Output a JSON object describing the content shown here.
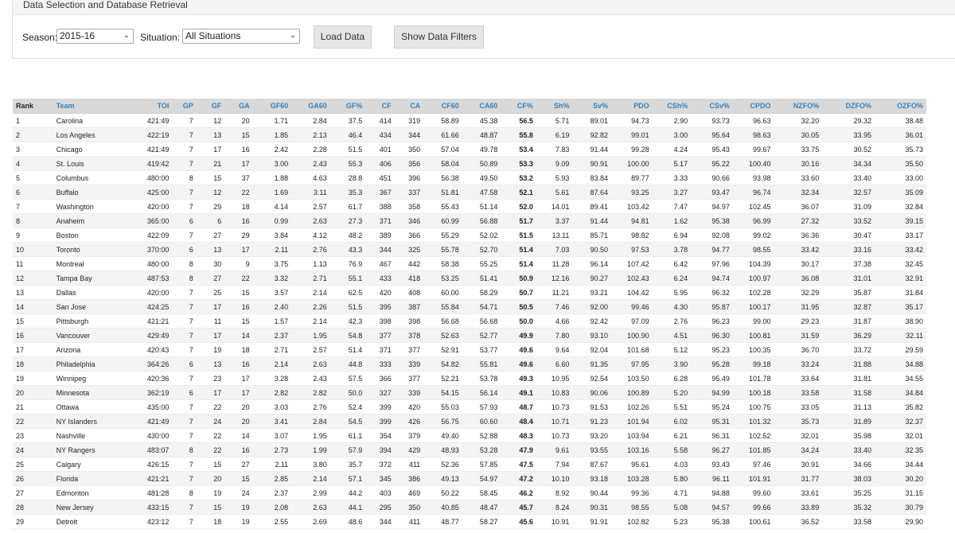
{
  "panel": {
    "title": "Data Selection and Database Retrieval",
    "season_label": "Season:",
    "season_value": "2015-16",
    "situation_label": "Situation:",
    "situation_value": "All Situations",
    "load_button": "Load Data",
    "filters_button": "Show Data Filters"
  },
  "table": {
    "columns": [
      "Rank",
      "Team",
      "TOI",
      "GP",
      "GF",
      "GA",
      "GF60",
      "GA60",
      "GF%",
      "CF",
      "CA",
      "CF60",
      "CA60",
      "CF%",
      "Sh%",
      "Sv%",
      "PDO",
      "CSh%",
      "CSv%",
      "CPDO",
      "NZFO%",
      "DZFO%",
      "OZFO%"
    ],
    "rows": [
      [
        "1",
        "Carolina",
        "421:49",
        "7",
        "12",
        "20",
        "1.71",
        "2.84",
        "37.5",
        "414",
        "319",
        "58.89",
        "45.38",
        "56.5",
        "5.71",
        "89.01",
        "94.73",
        "2.90",
        "93.73",
        "96.63",
        "32.20",
        "29.32",
        "38.48"
      ],
      [
        "2",
        "Los Angeles",
        "422:19",
        "7",
        "13",
        "15",
        "1.85",
        "2.13",
        "46.4",
        "434",
        "344",
        "61.66",
        "48.87",
        "55.8",
        "6.19",
        "92.82",
        "99.01",
        "3.00",
        "95.64",
        "98.63",
        "30.05",
        "33.95",
        "36.01"
      ],
      [
        "3",
        "Chicago",
        "421:49",
        "7",
        "17",
        "16",
        "2.42",
        "2.28",
        "51.5",
        "401",
        "350",
        "57.04",
        "49.78",
        "53.4",
        "7.83",
        "91.44",
        "99.28",
        "4.24",
        "95.43",
        "99.67",
        "33.75",
        "30.52",
        "35.73"
      ],
      [
        "4",
        "St. Louis",
        "419:42",
        "7",
        "21",
        "17",
        "3.00",
        "2.43",
        "55.3",
        "406",
        "356",
        "58.04",
        "50.89",
        "53.3",
        "9.09",
        "90.91",
        "100.00",
        "5.17",
        "95.22",
        "100.40",
        "30.16",
        "34.34",
        "35.50"
      ],
      [
        "5",
        "Columbus",
        "480:00",
        "8",
        "15",
        "37",
        "1.88",
        "4.63",
        "28.8",
        "451",
        "396",
        "56.38",
        "49.50",
        "53.2",
        "5.93",
        "83.84",
        "89.77",
        "3.33",
        "90.66",
        "93.98",
        "33.60",
        "33.40",
        "33.00"
      ],
      [
        "6",
        "Buffalo",
        "425:00",
        "7",
        "12",
        "22",
        "1.69",
        "3.11",
        "35.3",
        "367",
        "337",
        "51.81",
        "47.58",
        "52.1",
        "5.61",
        "87.64",
        "93.25",
        "3.27",
        "93.47",
        "96.74",
        "32.34",
        "32.57",
        "35.09"
      ],
      [
        "7",
        "Washington",
        "420:00",
        "7",
        "29",
        "18",
        "4.14",
        "2.57",
        "61.7",
        "388",
        "358",
        "55.43",
        "51.14",
        "52.0",
        "14.01",
        "89.41",
        "103.42",
        "7.47",
        "94.97",
        "102.45",
        "36.07",
        "31.09",
        "32.84"
      ],
      [
        "8",
        "Anaheim",
        "365:00",
        "6",
        "6",
        "16",
        "0.99",
        "2.63",
        "27.3",
        "371",
        "346",
        "60.99",
        "56.88",
        "51.7",
        "3.37",
        "91.44",
        "94.81",
        "1.62",
        "95.38",
        "96.99",
        "27.32",
        "33.52",
        "39.15"
      ],
      [
        "9",
        "Boston",
        "422:09",
        "7",
        "27",
        "29",
        "3.84",
        "4.12",
        "48.2",
        "389",
        "366",
        "55.29",
        "52.02",
        "51.5",
        "13.11",
        "85.71",
        "98.82",
        "6.94",
        "92.08",
        "99.02",
        "36.36",
        "30.47",
        "33.17"
      ],
      [
        "10",
        "Toronto",
        "370:00",
        "6",
        "13",
        "17",
        "2.11",
        "2.76",
        "43.3",
        "344",
        "325",
        "55.78",
        "52.70",
        "51.4",
        "7.03",
        "90.50",
        "97.53",
        "3.78",
        "94.77",
        "98.55",
        "33.42",
        "33.16",
        "33.42"
      ],
      [
        "11",
        "Montreal",
        "480:00",
        "8",
        "30",
        "9",
        "3.75",
        "1.13",
        "76.9",
        "467",
        "442",
        "58.38",
        "55.25",
        "51.4",
        "11.28",
        "96.14",
        "107.42",
        "6.42",
        "97.96",
        "104.39",
        "30.17",
        "37.38",
        "32.45"
      ],
      [
        "12",
        "Tampa Bay",
        "487:53",
        "8",
        "27",
        "22",
        "3.32",
        "2.71",
        "55.1",
        "433",
        "418",
        "53.25",
        "51.41",
        "50.9",
        "12.16",
        "90.27",
        "102.43",
        "6.24",
        "94.74",
        "100.97",
        "36.08",
        "31.01",
        "32.91"
      ],
      [
        "13",
        "Dallas",
        "420:00",
        "7",
        "25",
        "15",
        "3.57",
        "2.14",
        "62.5",
        "420",
        "408",
        "60.00",
        "58.29",
        "50.7",
        "11.21",
        "93.21",
        "104.42",
        "5.95",
        "96.32",
        "102.28",
        "32.29",
        "35.87",
        "31.84"
      ],
      [
        "14",
        "San Jose",
        "424:25",
        "7",
        "17",
        "16",
        "2.40",
        "2.26",
        "51.5",
        "395",
        "387",
        "55.84",
        "54.71",
        "50.5",
        "7.46",
        "92.00",
        "99.46",
        "4.30",
        "95.87",
        "100.17",
        "31.95",
        "32.87",
        "35.17"
      ],
      [
        "15",
        "Pittsburgh",
        "421:21",
        "7",
        "11",
        "15",
        "1.57",
        "2.14",
        "42.3",
        "398",
        "398",
        "56.68",
        "56.68",
        "50.0",
        "4.66",
        "92.42",
        "97.09",
        "2.76",
        "96.23",
        "99.00",
        "29.23",
        "31.87",
        "38.90"
      ],
      [
        "16",
        "Vancouver",
        "429:49",
        "7",
        "17",
        "14",
        "2.37",
        "1.95",
        "54.8",
        "377",
        "378",
        "52.63",
        "52.77",
        "49.9",
        "7.80",
        "93.10",
        "100.90",
        "4.51",
        "96.30",
        "100.81",
        "31.59",
        "36.29",
        "32.11"
      ],
      [
        "17",
        "Arizona",
        "420:43",
        "7",
        "19",
        "18",
        "2.71",
        "2.57",
        "51.4",
        "371",
        "377",
        "52.91",
        "53.77",
        "49.6",
        "9.64",
        "92.04",
        "101.68",
        "5.12",
        "95.23",
        "100.35",
        "36.70",
        "33.72",
        "29.59"
      ],
      [
        "18",
        "Philadelphia",
        "364:26",
        "6",
        "13",
        "16",
        "2.14",
        "2.63",
        "44.8",
        "333",
        "339",
        "54.82",
        "55.81",
        "49.6",
        "6.60",
        "91.35",
        "97.95",
        "3.90",
        "95.28",
        "99.18",
        "33.24",
        "31.88",
        "34.88"
      ],
      [
        "19",
        "Winnipeg",
        "420:36",
        "7",
        "23",
        "17",
        "3.28",
        "2.43",
        "57.5",
        "366",
        "377",
        "52.21",
        "53.78",
        "49.3",
        "10.95",
        "92.54",
        "103.50",
        "6.28",
        "95.49",
        "101.78",
        "33.64",
        "31.81",
        "34.55"
      ],
      [
        "20",
        "Minnesota",
        "362:19",
        "6",
        "17",
        "17",
        "2.82",
        "2.82",
        "50.0",
        "327",
        "339",
        "54.15",
        "56.14",
        "49.1",
        "10.83",
        "90.06",
        "100.89",
        "5.20",
        "94.99",
        "100.18",
        "33.58",
        "31.58",
        "34.84"
      ],
      [
        "21",
        "Ottawa",
        "435:00",
        "7",
        "22",
        "20",
        "3.03",
        "2.76",
        "52.4",
        "399",
        "420",
        "55.03",
        "57.93",
        "48.7",
        "10.73",
        "91.53",
        "102.26",
        "5.51",
        "95.24",
        "100.75",
        "33.05",
        "31.13",
        "35.82"
      ],
      [
        "22",
        "NY Islanders",
        "421:49",
        "7",
        "24",
        "20",
        "3.41",
        "2.84",
        "54.5",
        "399",
        "426",
        "56.75",
        "60.60",
        "48.4",
        "10.71",
        "91.23",
        "101.94",
        "6.02",
        "95.31",
        "101.32",
        "35.73",
        "31.89",
        "32.37"
      ],
      [
        "23",
        "Nashville",
        "430:00",
        "7",
        "22",
        "14",
        "3.07",
        "1.95",
        "61.1",
        "354",
        "379",
        "49.40",
        "52.88",
        "48.3",
        "10.73",
        "93.20",
        "103.94",
        "6.21",
        "96.31",
        "102.52",
        "32.01",
        "35.98",
        "32.01"
      ],
      [
        "24",
        "NY Rangers",
        "483:07",
        "8",
        "22",
        "16",
        "2.73",
        "1.99",
        "57.9",
        "394",
        "429",
        "48.93",
        "53.28",
        "47.9",
        "9.61",
        "93.55",
        "103.16",
        "5.58",
        "96.27",
        "101.85",
        "34.24",
        "33.40",
        "32.35"
      ],
      [
        "25",
        "Calgary",
        "426:15",
        "7",
        "15",
        "27",
        "2.11",
        "3.80",
        "35.7",
        "372",
        "411",
        "52.36",
        "57.85",
        "47.5",
        "7.94",
        "87.67",
        "95.61",
        "4.03",
        "93.43",
        "97.46",
        "30.91",
        "34.66",
        "34.44"
      ],
      [
        "26",
        "Florida",
        "421:21",
        "7",
        "20",
        "15",
        "2.85",
        "2.14",
        "57.1",
        "345",
        "386",
        "49.13",
        "54.97",
        "47.2",
        "10.10",
        "93.18",
        "103.28",
        "5.80",
        "96.11",
        "101.91",
        "31.77",
        "38.03",
        "30.20"
      ],
      [
        "27",
        "Edmonton",
        "481:28",
        "8",
        "19",
        "24",
        "2.37",
        "2.99",
        "44.2",
        "403",
        "469",
        "50.22",
        "58.45",
        "46.2",
        "8.92",
        "90.44",
        "99.36",
        "4.71",
        "94.88",
        "99.60",
        "33.61",
        "35.25",
        "31.15"
      ],
      [
        "28",
        "New Jersey",
        "433:15",
        "7",
        "15",
        "19",
        "2.08",
        "2.63",
        "44.1",
        "295",
        "350",
        "40.85",
        "48.47",
        "45.7",
        "8.24",
        "90.31",
        "98.55",
        "5.08",
        "94.57",
        "99.66",
        "33.89",
        "35.32",
        "30.79"
      ],
      [
        "29",
        "Detroit",
        "423:12",
        "7",
        "18",
        "19",
        "2.55",
        "2.69",
        "48.6",
        "344",
        "411",
        "48.77",
        "58.27",
        "45.6",
        "10.91",
        "91.91",
        "102.82",
        "5.23",
        "95.38",
        "100.61",
        "36.52",
        "33.58",
        "29.90"
      ]
    ]
  }
}
